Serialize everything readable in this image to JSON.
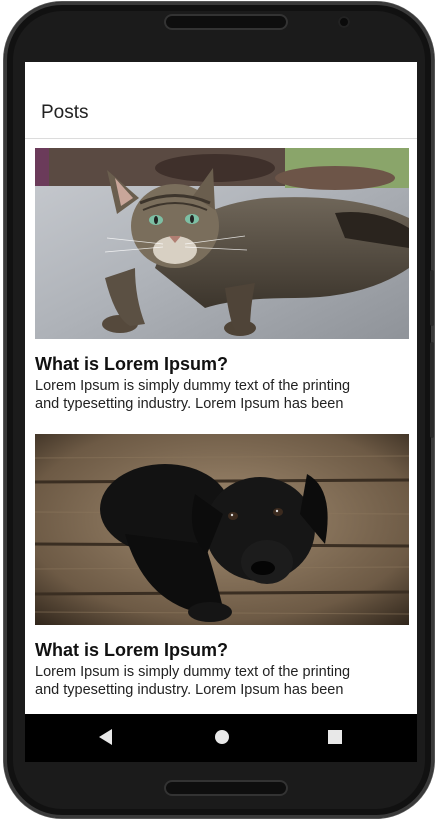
{
  "app": {
    "title": "Posts"
  },
  "posts": [
    {
      "title": "What is Lorem Ipsum?",
      "line1": "Lorem Ipsum is simply dummy text of the printing",
      "line2": "and typesetting industry. Lorem Ipsum has been",
      "image": "cat-photo"
    },
    {
      "title": "What is Lorem Ipsum?",
      "line1": "Lorem Ipsum is simply dummy text of the printing",
      "line2": "and typesetting industry. Lorem Ipsum has been",
      "image": "black-puppy-photo"
    }
  ],
  "navbar": {
    "icons": [
      "back-icon",
      "home-icon",
      "recents-icon"
    ]
  },
  "colors": {
    "appbar_bg": "#ffffff",
    "navbar_bg": "#000000",
    "phone_frame": "#1b1b1b"
  }
}
